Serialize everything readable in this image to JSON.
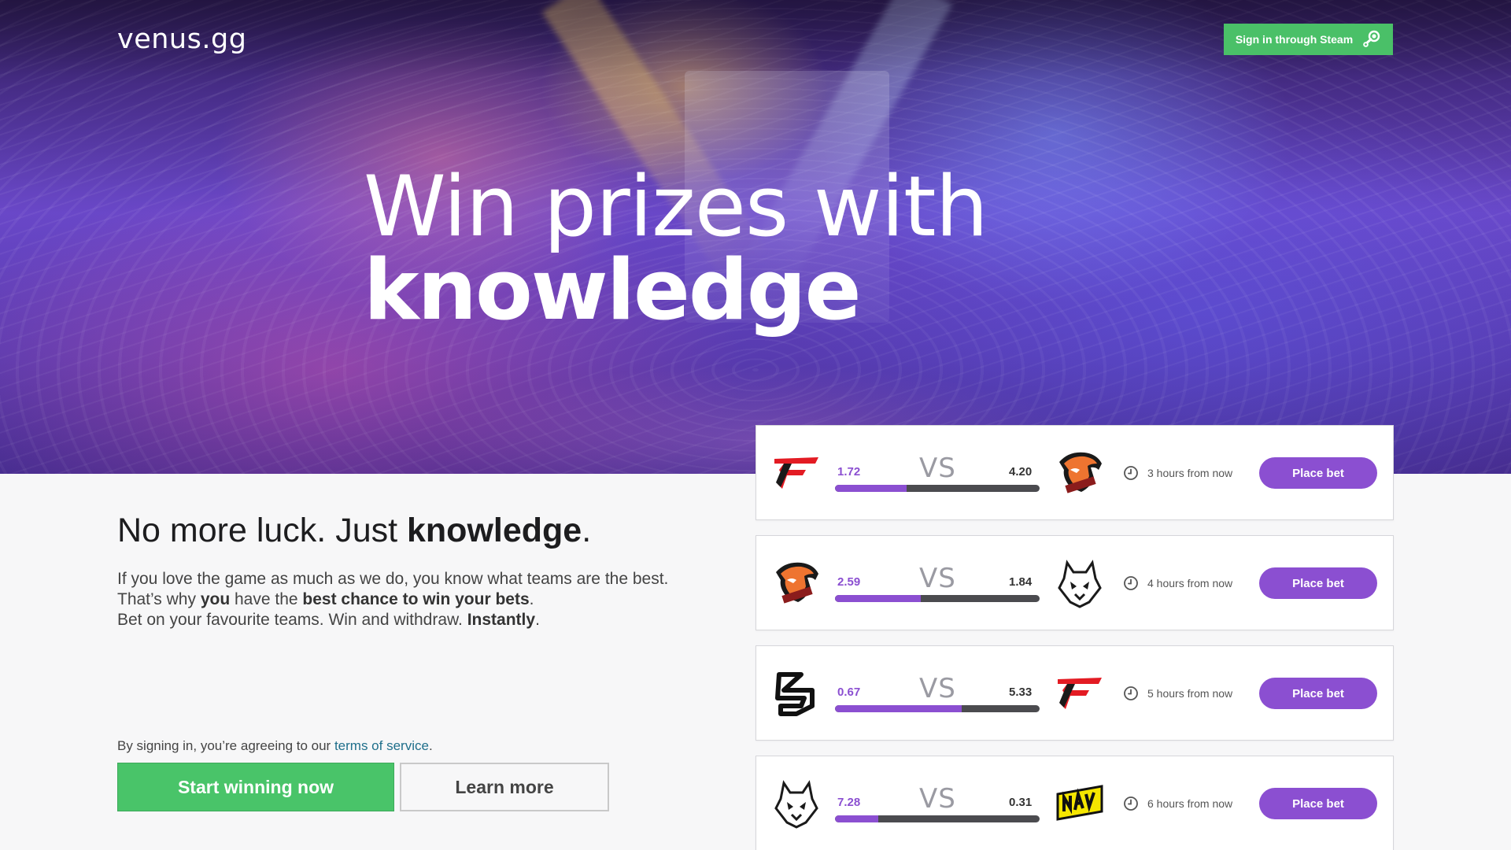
{
  "header": {
    "logo": "venus.gg",
    "signin_label": "Sign in through Steam"
  },
  "hero": {
    "line1": "Win prizes with",
    "line2": "knowledge"
  },
  "intro": {
    "title_plain": "No more luck. Just ",
    "title_bold": "knowledge",
    "title_end": ".",
    "p1": "If you love the game as much as we do, you know what teams are the best.",
    "p2a": "That’s why ",
    "p2b": "you",
    "p2c": " have the ",
    "p2d": "best chance to win your bets",
    "p2e": ".",
    "p3a": "Bet on your favourite teams. Win and withdraw. ",
    "p3b": "Instantly",
    "p3c": "."
  },
  "terms": {
    "prefix": "By signing in, you’re agreeing to our ",
    "link": "terms of service",
    "suffix": "."
  },
  "cta": {
    "start": "Start winning now",
    "learn": "Learn more"
  },
  "vs_label": "VS",
  "bet_label": "Place bet",
  "colors": {
    "accent": "#8b4fd1",
    "green": "#49c469"
  },
  "matches": [
    {
      "left_team": "faze-logo",
      "right_team": "virtus-pro-logo",
      "odd_left": "1.72",
      "odd_right": "4.20",
      "share_left": 0.35,
      "time": "3 hours from now"
    },
    {
      "left_team": "virtus-pro-logo",
      "right_team": "g2-logo",
      "odd_left": "2.59",
      "odd_right": "1.84",
      "share_left": 0.42,
      "time": "4 hours from now"
    },
    {
      "left_team": "sk-logo",
      "right_team": "faze-logo",
      "odd_left": "0.67",
      "odd_right": "5.33",
      "share_left": 0.62,
      "time": "5 hours from now"
    },
    {
      "left_team": "g2-logo",
      "right_team": "navi-logo",
      "odd_left": "7.28",
      "odd_right": "0.31",
      "share_left": 0.21,
      "time": "6 hours from now"
    }
  ]
}
